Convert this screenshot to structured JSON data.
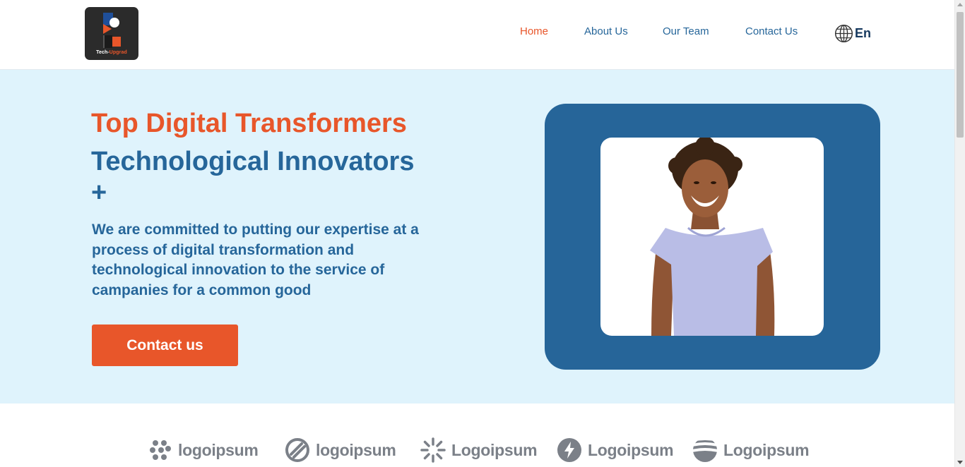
{
  "brand": {
    "logo_text_a": "Tech-",
    "logo_text_b": "Upgrad"
  },
  "nav": {
    "items": [
      {
        "label": "Home"
      },
      {
        "label": "About Us"
      },
      {
        "label": "Our Team"
      },
      {
        "label": "Contact Us"
      }
    ],
    "language": "En"
  },
  "hero": {
    "title_line1": "Top Digital Transformers",
    "title_line2": "Technological Innovators",
    "title_plus": "+",
    "description": "We are committed to putting our expertise at a process of digital transformation and technological innovation to the service of campanies for a common good",
    "cta_label": "Contact us"
  },
  "partners": [
    {
      "name": "logoipsum",
      "icon": "dots-logo-icon"
    },
    {
      "name": "logoipsum",
      "icon": "circle-slash-logo-icon"
    },
    {
      "name": "Logoipsum",
      "icon": "sunburst-logo-icon"
    },
    {
      "name": "Logoipsum",
      "icon": "lightning-logo-icon"
    },
    {
      "name": "Logoipsum",
      "icon": "wave-globe-logo-icon"
    }
  ],
  "colors": {
    "accent_orange": "#e8562a",
    "primary_blue": "#26669a",
    "hero_bg": "#dff3fc",
    "frame_blue": "#266599"
  }
}
